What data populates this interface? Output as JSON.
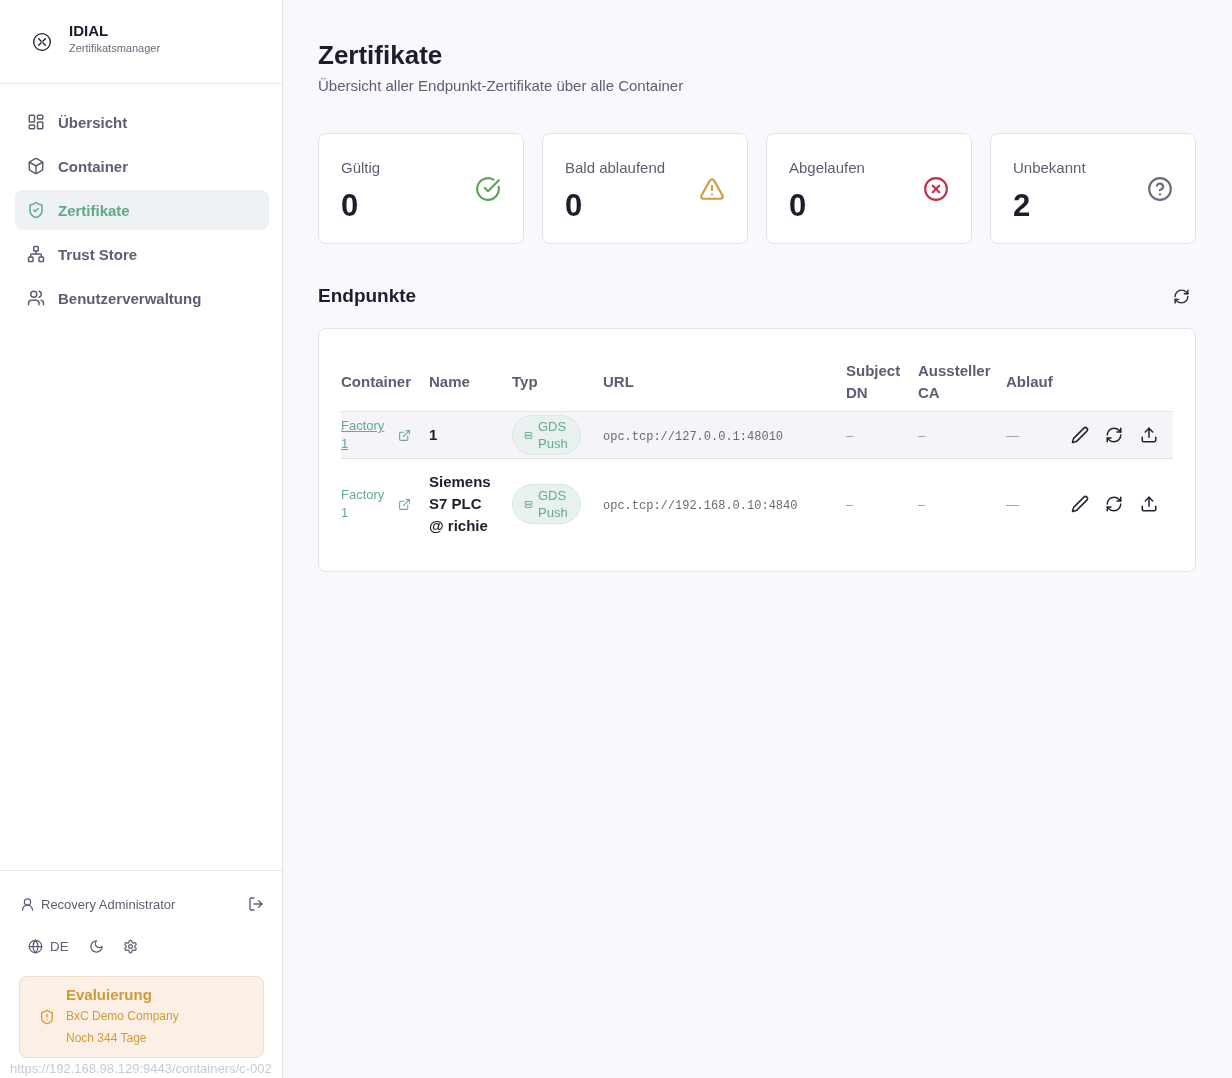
{
  "sidebar": {
    "brand": {
      "title": "IDIAL",
      "subtitle": "Zertifikatsmanager"
    },
    "nav": [
      {
        "label": "Übersicht",
        "kind": "overview",
        "selected": false
      },
      {
        "label": "Container",
        "kind": "container",
        "selected": false
      },
      {
        "label": "Zertifikate",
        "kind": "certificates",
        "selected": true
      },
      {
        "label": "Trust Store",
        "kind": "trust-store",
        "selected": false
      },
      {
        "label": "Benutzerverwaltung",
        "kind": "users",
        "selected": false
      }
    ],
    "user": "Recovery Administrator",
    "language": "DE",
    "license": {
      "title": "Evaluierung",
      "company": "BxC Demo Company",
      "remaining": "Noch 344 Tage"
    }
  },
  "header": {
    "title": "Zertifikate",
    "subtitle": "Übersicht aller Endpunkt-Zertifikate über alle Container"
  },
  "stats": [
    {
      "label": "Gültig",
      "value": "0",
      "kind": "valid"
    },
    {
      "label": "Bald ablaufend",
      "value": "0",
      "kind": "expiring"
    },
    {
      "label": "Abgelaufen",
      "value": "0",
      "kind": "expired"
    },
    {
      "label": "Unbekannt",
      "value": "2",
      "kind": "unknown"
    }
  ],
  "endpoints": {
    "title": "Endpunkte",
    "table": {
      "columns": [
        "Container",
        "Name",
        "Typ",
        "URL",
        "Subject DN",
        "Aussteller CA",
        "Ablauf"
      ],
      "rows": [
        {
          "container": "Factory 1",
          "name": "1",
          "type": "GDS Push",
          "url": "opc.tcp://127.0.0.1:48010",
          "subject_dn": "–",
          "issuer_ca": "–",
          "expiry": "—",
          "hovered": true
        },
        {
          "container": "Factory 1",
          "name": "Siemens S7 PLC @ richie",
          "type": "GDS Push",
          "url": "opc.tcp://192.168.0.10:4840",
          "subject_dn": "–",
          "issuer_ca": "–",
          "expiry": "—",
          "hovered": false
        }
      ]
    }
  },
  "link_preview": "https://192.168.98.129:9443/containers/c-002"
}
